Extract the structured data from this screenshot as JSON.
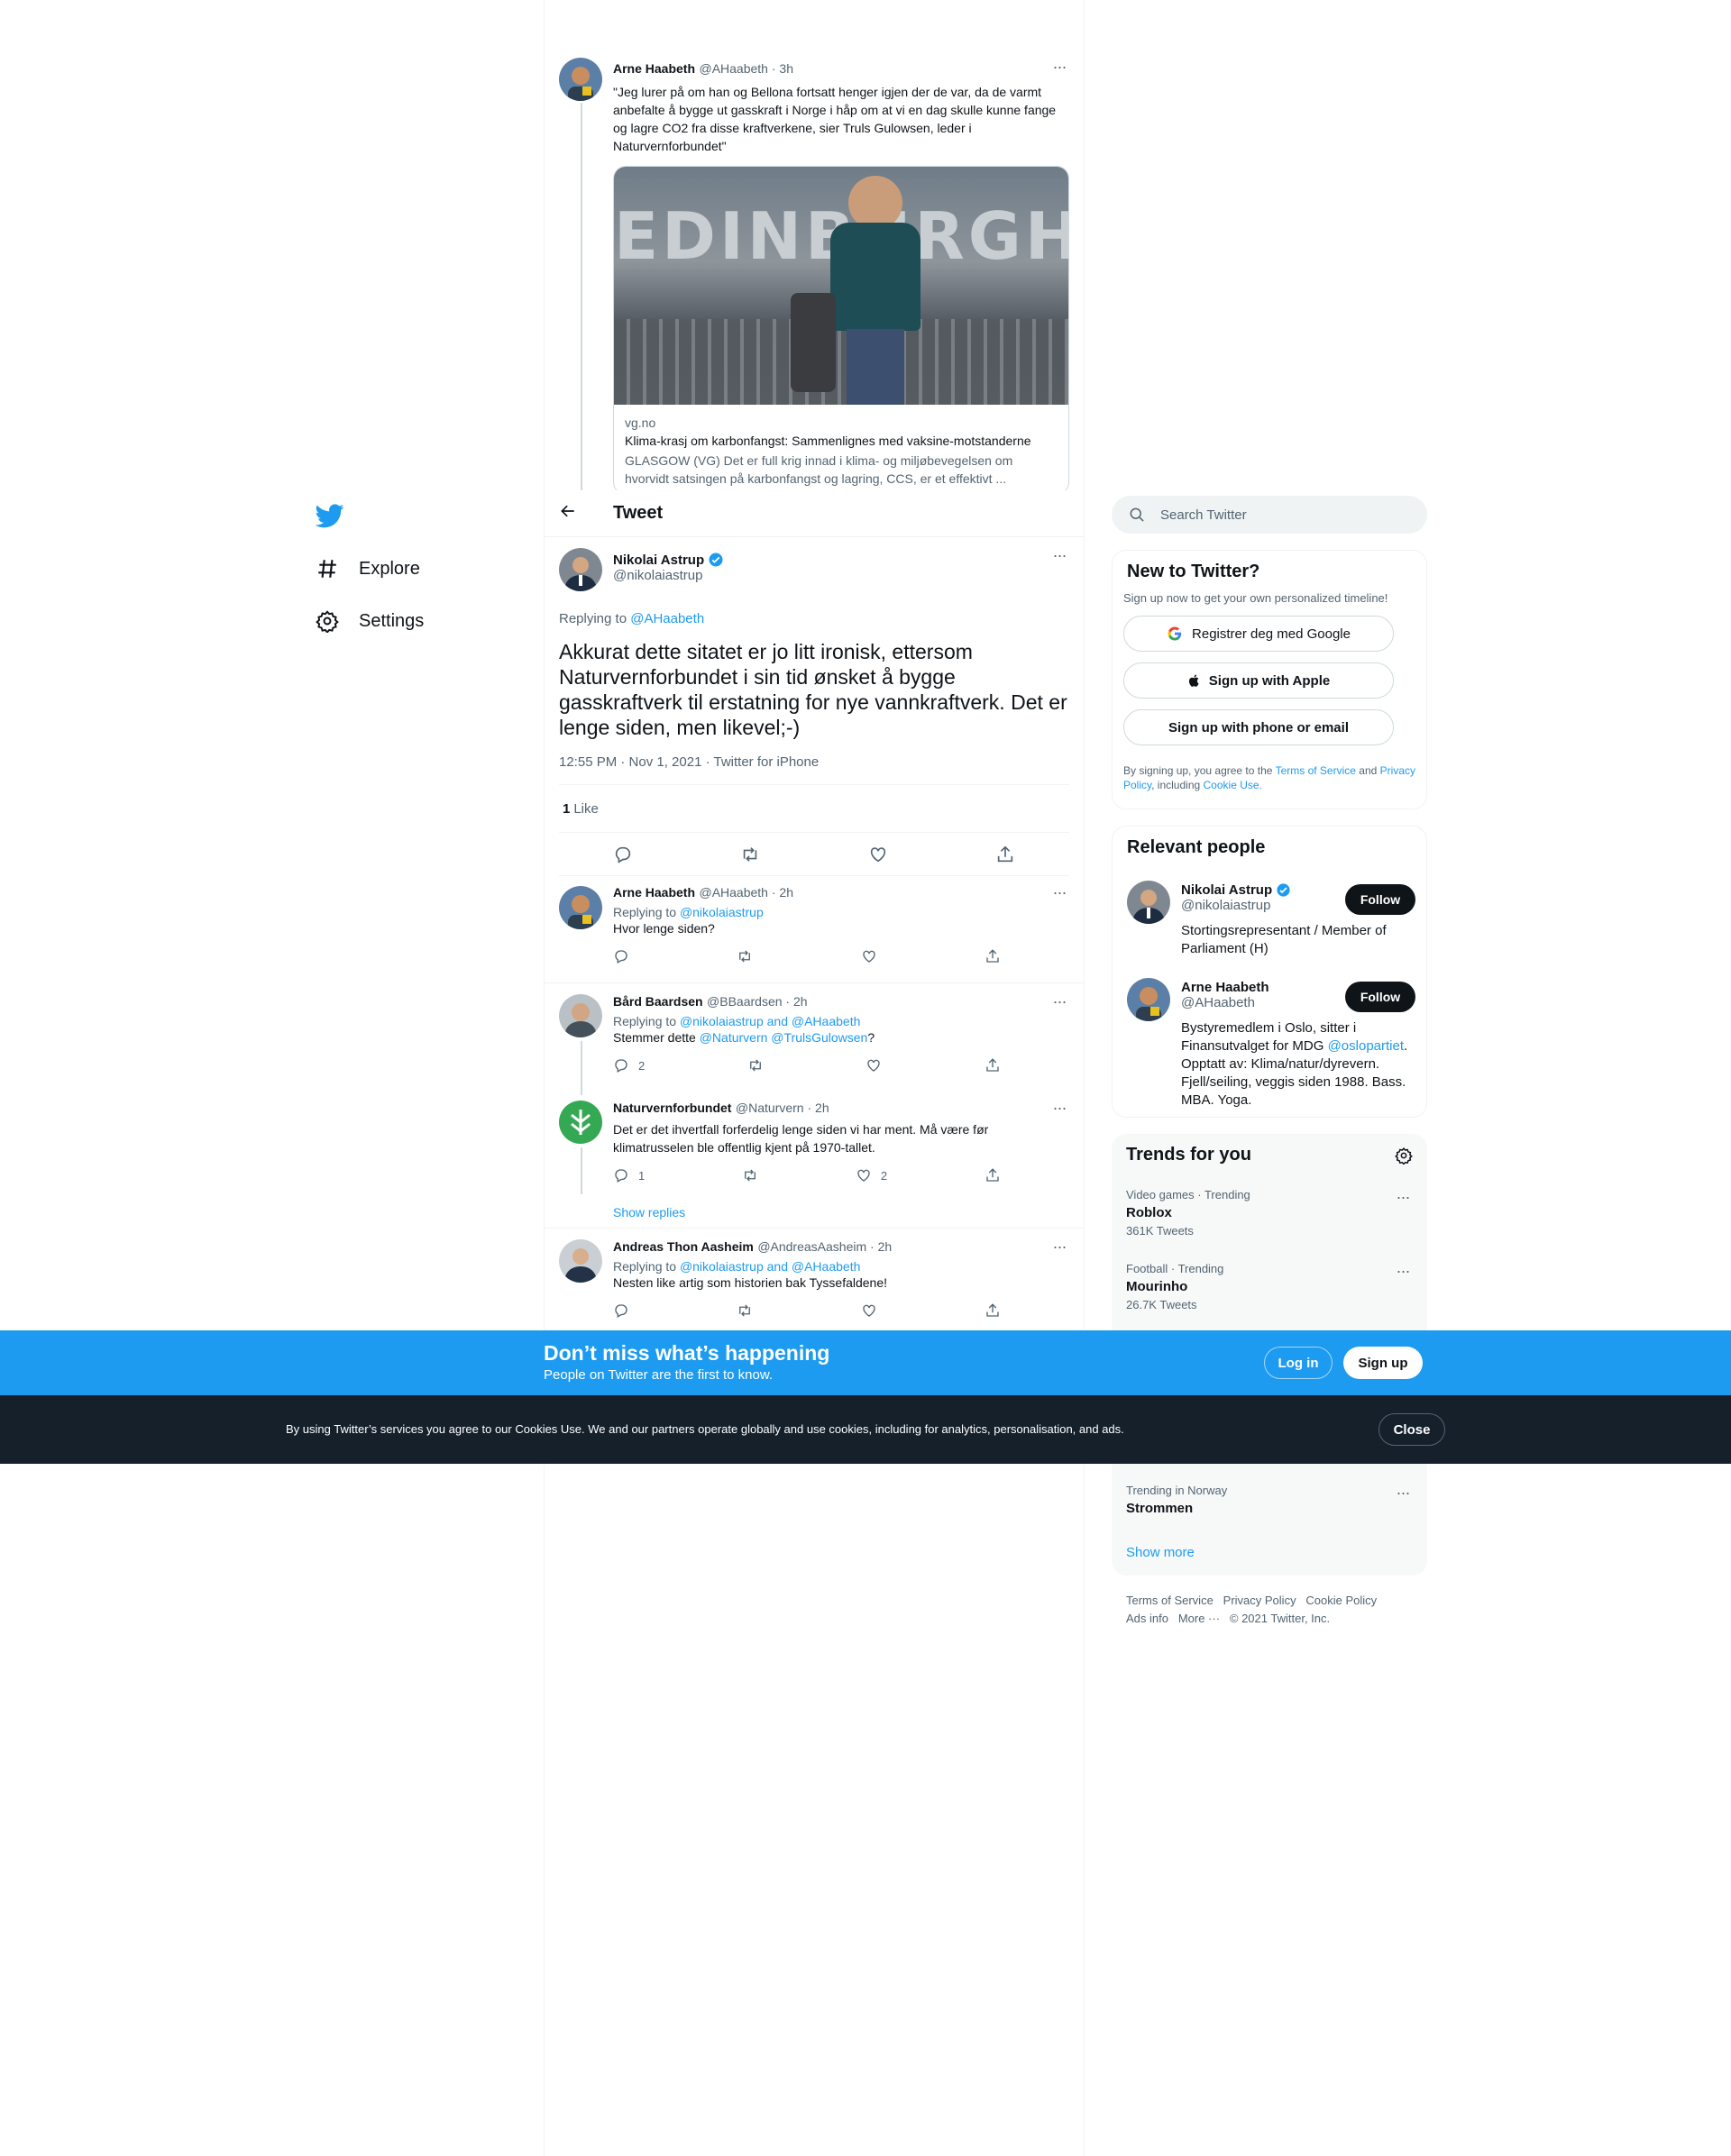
{
  "nav": {
    "explore": "Explore",
    "settings": "Settings"
  },
  "parent_tweet": {
    "name": "Arne Haabeth",
    "handle_time": "@AHaabeth · 3h",
    "text": "\"Jeg lurer på om han og Bellona fortsatt henger igjen der de var, da de varmt anbefalte å bygge ut gasskraft i Norge i håp om at vi en dag skulle kunne fange og lagre CO2 fra disse kraftverkene, sier Truls Gulowsen, leder i Naturvernforbundet\"",
    "card": {
      "image_text": "EDINBURGH",
      "domain": "vg.no",
      "title": "Klima-krasj om karbonfangst: Sammenlignes med vaksine-motstanderne",
      "description": "GLASGOW (VG) Det er full krig innad i klima- og miljøbevegelsen om hvorvidt satsingen på karbonfangst og lagring, CCS, er et effektivt ..."
    }
  },
  "header": {
    "title": "Tweet"
  },
  "main_tweet": {
    "name": "Nikolai Astrup",
    "handle": "@nikolaiastrup",
    "replying_prefix": "Replying to",
    "replying_handle": "@AHaabeth",
    "text": "Akkurat dette sitatet er jo litt ironisk, ettersom Naturvernforbundet i sin tid ønsket å bygge gasskraftverk til erstatning for nye vannkraftverk. Det er lenge siden, men likevel;-)",
    "meta": "12:55 PM · Nov 1, 2021 · Twitter for iPhone",
    "likes_count": "1",
    "likes_label": "Like"
  },
  "replies": [
    {
      "name": "Arne Haabeth",
      "handle_time": "@AHaabeth · 2h",
      "replying_prefix": "Replying to",
      "replying": "@nikolaiastrup",
      "text": "Hvor lenge siden?",
      "reply_count": "",
      "like_count": ""
    },
    {
      "name": "Bård Baardsen",
      "handle_time": "@BBaardsen · 2h",
      "replying_prefix": "Replying to",
      "replying": "@nikolaiastrup and @AHaabeth",
      "text_pre": "Stemmer dette",
      "mention": "@Naturvern @TrulsGulowsen",
      "text_post": "?",
      "reply_count": "2",
      "like_count": ""
    },
    {
      "name": "Naturvernforbundet",
      "handle_time": "@Naturvern · 2h",
      "text": "Det er det ihvertfall forferdelig lenge siden vi har ment. Må være før klimatrusselen ble offentlig kjent på 1970-tallet.",
      "reply_count": "1",
      "like_count": "2"
    },
    {
      "show_replies": "Show replies"
    },
    {
      "name": "Andreas Thon Aasheim",
      "handle_time": "@AndreasAasheim · 2h",
      "replying_prefix": "Replying to",
      "replying": "@nikolaiastrup and @AHaabeth",
      "text": "Nesten like artig som historien bak Tyssefaldene!"
    }
  ],
  "search": {
    "placeholder": "Search Twitter"
  },
  "signup_card": {
    "title": "New to Twitter?",
    "subtitle": "Sign up now to get your own personalized timeline!",
    "google": "Registrer deg med Google",
    "apple": "Sign up with Apple",
    "phone": "Sign up with phone or email",
    "legal_1": "By signing up, you agree to the",
    "tos": "Terms of Service",
    "and": "and",
    "privacy": "Privacy Policy",
    "including": ", including",
    "cookie": "Cookie Use."
  },
  "relevant_people": {
    "title": "Relevant people",
    "people": [
      {
        "name": "Nikolai Astrup",
        "handle": "@nikolaiastrup",
        "follow": "Follow",
        "bio": "Stortingsrepresentant / Member of Parliament (H)"
      },
      {
        "name": "Arne Haabeth",
        "handle": "@AHaabeth",
        "follow": "Follow",
        "bio_pre": "Bystyremedlem i Oslo, sitter i Finansutvalget for MDG",
        "bio_link": "@oslopartiet",
        "bio_post": ". Opptatt av: Klima/natur/dyrevern. Fjell/seiling, veggis siden 1988. Bass. MBA. Yoga."
      }
    ]
  },
  "trends": {
    "title": "Trends for you",
    "items": [
      {
        "meta": "Video games · Trending",
        "name": "Roblox",
        "count": "361K Tweets"
      },
      {
        "meta": "Football · Trending",
        "name": "Mourinho",
        "count": "26.7K Tweets"
      },
      {
        "meta": "Trending in Norway",
        "name": "Strommen",
        "count": ""
      }
    ],
    "show_more": "Show more"
  },
  "footer": {
    "tos": "Terms of Service",
    "privacy": "Privacy Policy",
    "cookie": "Cookie Policy",
    "ads": "Ads info",
    "more": "More ···",
    "copyright": "© 2021 Twitter, Inc."
  },
  "banner": {
    "title": "Don’t miss what’s happening",
    "subtitle": "People on Twitter are the first to know.",
    "login": "Log in",
    "signup": "Sign up"
  },
  "cookie_bar": {
    "text": "By using Twitter’s services you agree to our Cookies Use. We and our partners operate globally and use cookies, including for analytics, personalisation, and ads.",
    "close": "Close"
  },
  "colors": {
    "accent": "#1d9bf0",
    "cookie_bg": "#15202b",
    "text": "#0f1419",
    "muted": "#536471"
  }
}
